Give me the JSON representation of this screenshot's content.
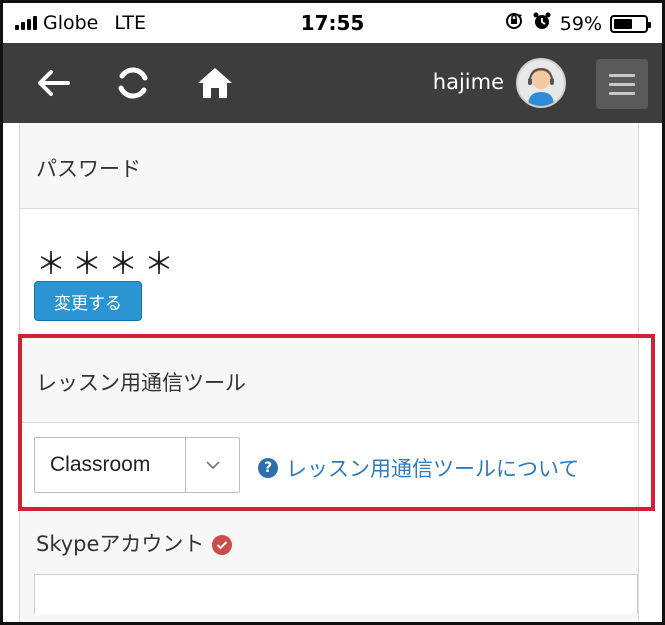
{
  "status_bar": {
    "carrier": "Globe",
    "network": "LTE",
    "time": "17:55",
    "battery_text": "59%",
    "battery_level": 0.59
  },
  "navbar": {
    "icons": [
      "back-arrow-icon",
      "refresh-icon",
      "home-icon",
      "avatar-icon",
      "hamburger-menu-icon"
    ],
    "username": "hajime"
  },
  "password_section": {
    "label": "パスワード",
    "value": "＊＊＊＊",
    "change_button": "変更する"
  },
  "tool_section": {
    "label": "レッスン用通信ツール",
    "selected_tool": "Classroom",
    "help_link": "レッスン用通信ツールについて"
  },
  "skype_section": {
    "label": "Skypeアカウント"
  },
  "colors": {
    "navbar_bg": "#3d3d3d",
    "button_blue": "#2a95d2",
    "link_blue": "#2d7cc0",
    "highlight_red": "#d41f36",
    "check_red": "#c94d4d"
  }
}
